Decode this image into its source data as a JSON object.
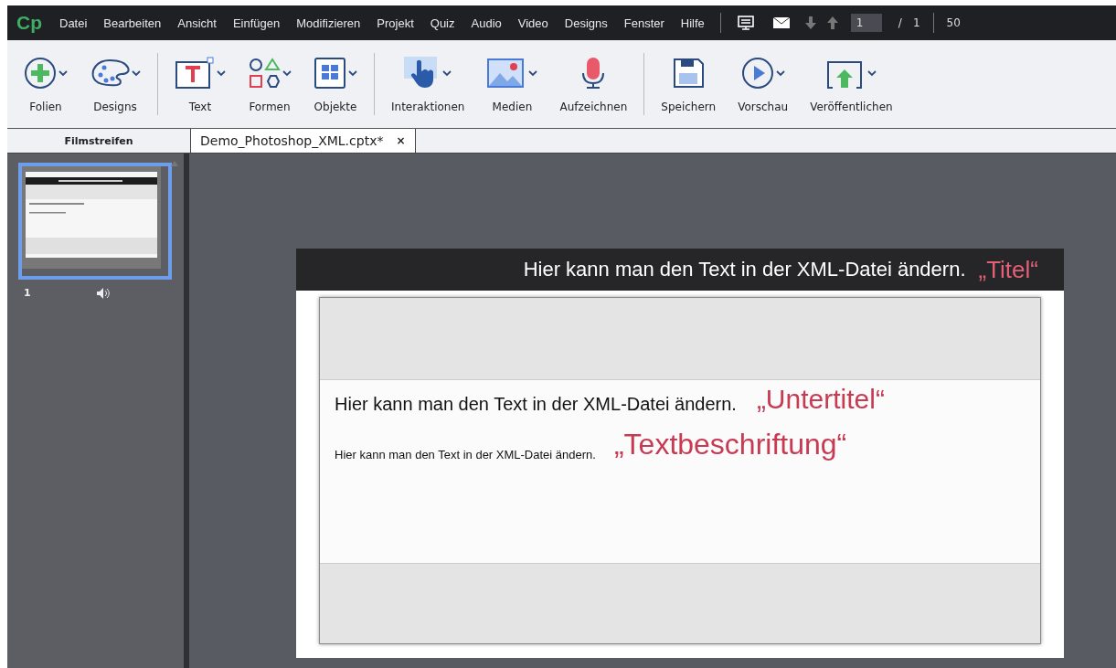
{
  "app": {
    "logo": "Cp"
  },
  "menu": [
    "Datei",
    "Bearbeiten",
    "Ansicht",
    "Einfügen",
    "Modifizieren",
    "Projekt",
    "Quiz",
    "Audio",
    "Video",
    "Designs",
    "Fenster",
    "Hilfe"
  ],
  "slide_nav": {
    "current": "1",
    "separator": "/",
    "total": "1",
    "zoom": "50"
  },
  "toolbar_groups": [
    [
      {
        "label": "Folien",
        "kind": "plus",
        "dropdown": true
      },
      {
        "label": "Designs",
        "kind": "palette",
        "dropdown": true
      }
    ],
    [
      {
        "label": "Text",
        "kind": "text",
        "dropdown": true
      },
      {
        "label": "Formen",
        "kind": "shapes",
        "dropdown": true
      },
      {
        "label": "Objekte",
        "kind": "grid",
        "dropdown": true
      }
    ],
    [
      {
        "label": "Interaktionen",
        "kind": "hand",
        "dropdown": true
      },
      {
        "label": "Medien",
        "kind": "image",
        "dropdown": true
      },
      {
        "label": "Aufzeichnen",
        "kind": "mic",
        "dropdown": false
      }
    ],
    [
      {
        "label": "Speichern",
        "kind": "save",
        "dropdown": false
      },
      {
        "label": "Vorschau",
        "kind": "play",
        "dropdown": true
      },
      {
        "label": "Veröffentlichen",
        "kind": "publish",
        "dropdown": true
      }
    ]
  ],
  "filmstrip": {
    "title": "Filmstreifen",
    "slides": [
      {
        "number": "1",
        "selected": true,
        "audio": true
      }
    ]
  },
  "document_tab": {
    "title": "Demo_Photoshop_XML.cptx*",
    "close": "×"
  },
  "slide": {
    "title": {
      "text": "Hier kann man den Text in der XML-Datei ändern.",
      "note": "„Titel“"
    },
    "subtitle": {
      "text": "Hier kann man den Text in der XML-Datei ändern.",
      "note": "„Untertitel“"
    },
    "caption": {
      "text": "Hier kann man den Text in der XML-Datei ändern.",
      "note": "„Textbeschriftung“"
    }
  }
}
